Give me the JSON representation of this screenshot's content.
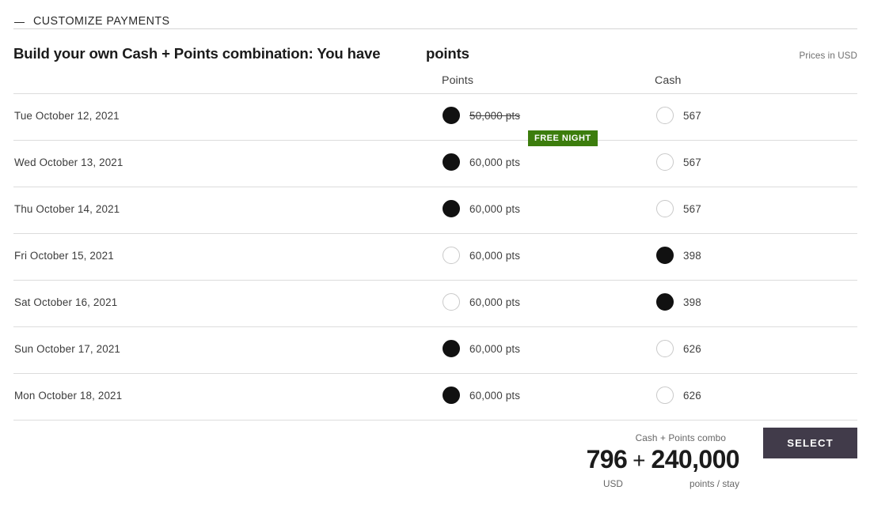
{
  "section": {
    "title": "CUSTOMIZE PAYMENTS",
    "collapse_icon": "minus-icon"
  },
  "build": {
    "headline": "Build your own Cash + Points combination: You have",
    "points_word": "points",
    "points_balance": "",
    "prices_note": "Prices in USD"
  },
  "columns": {
    "points": "Points",
    "cash": "Cash"
  },
  "badge": {
    "free_night": "FREE NIGHT",
    "color": "#3c7d0d"
  },
  "rows": [
    {
      "date": "Tue October 12, 2021",
      "points_label": "50,000 pts",
      "points_struck": true,
      "points_selected": true,
      "cash_label": "567",
      "cash_selected": false,
      "badge": "FREE NIGHT"
    },
    {
      "date": "Wed October 13, 2021",
      "points_label": "60,000 pts",
      "points_struck": false,
      "points_selected": true,
      "cash_label": "567",
      "cash_selected": false,
      "badge": ""
    },
    {
      "date": "Thu October 14, 2021",
      "points_label": "60,000 pts",
      "points_struck": false,
      "points_selected": true,
      "cash_label": "567",
      "cash_selected": false,
      "badge": ""
    },
    {
      "date": "Fri October 15, 2021",
      "points_label": "60,000 pts",
      "points_struck": false,
      "points_selected": false,
      "cash_label": "398",
      "cash_selected": true,
      "badge": ""
    },
    {
      "date": "Sat October 16, 2021",
      "points_label": "60,000 pts",
      "points_struck": false,
      "points_selected": false,
      "cash_label": "398",
      "cash_selected": true,
      "badge": ""
    },
    {
      "date": "Sun October 17, 2021",
      "points_label": "60,000 pts",
      "points_struck": false,
      "points_selected": true,
      "cash_label": "626",
      "cash_selected": false,
      "badge": ""
    },
    {
      "date": "Mon October 18, 2021",
      "points_label": "60,000 pts",
      "points_struck": false,
      "points_selected": true,
      "cash_label": "626",
      "cash_selected": false,
      "badge": ""
    }
  ],
  "footer": {
    "combo_label": "Cash + Points combo",
    "total_cash": "796",
    "plus": "+",
    "total_points": "240,000",
    "currency_label": "USD",
    "points_unit_label": "points / stay",
    "select_label": "SELECT",
    "select_color": "#413b4a"
  }
}
